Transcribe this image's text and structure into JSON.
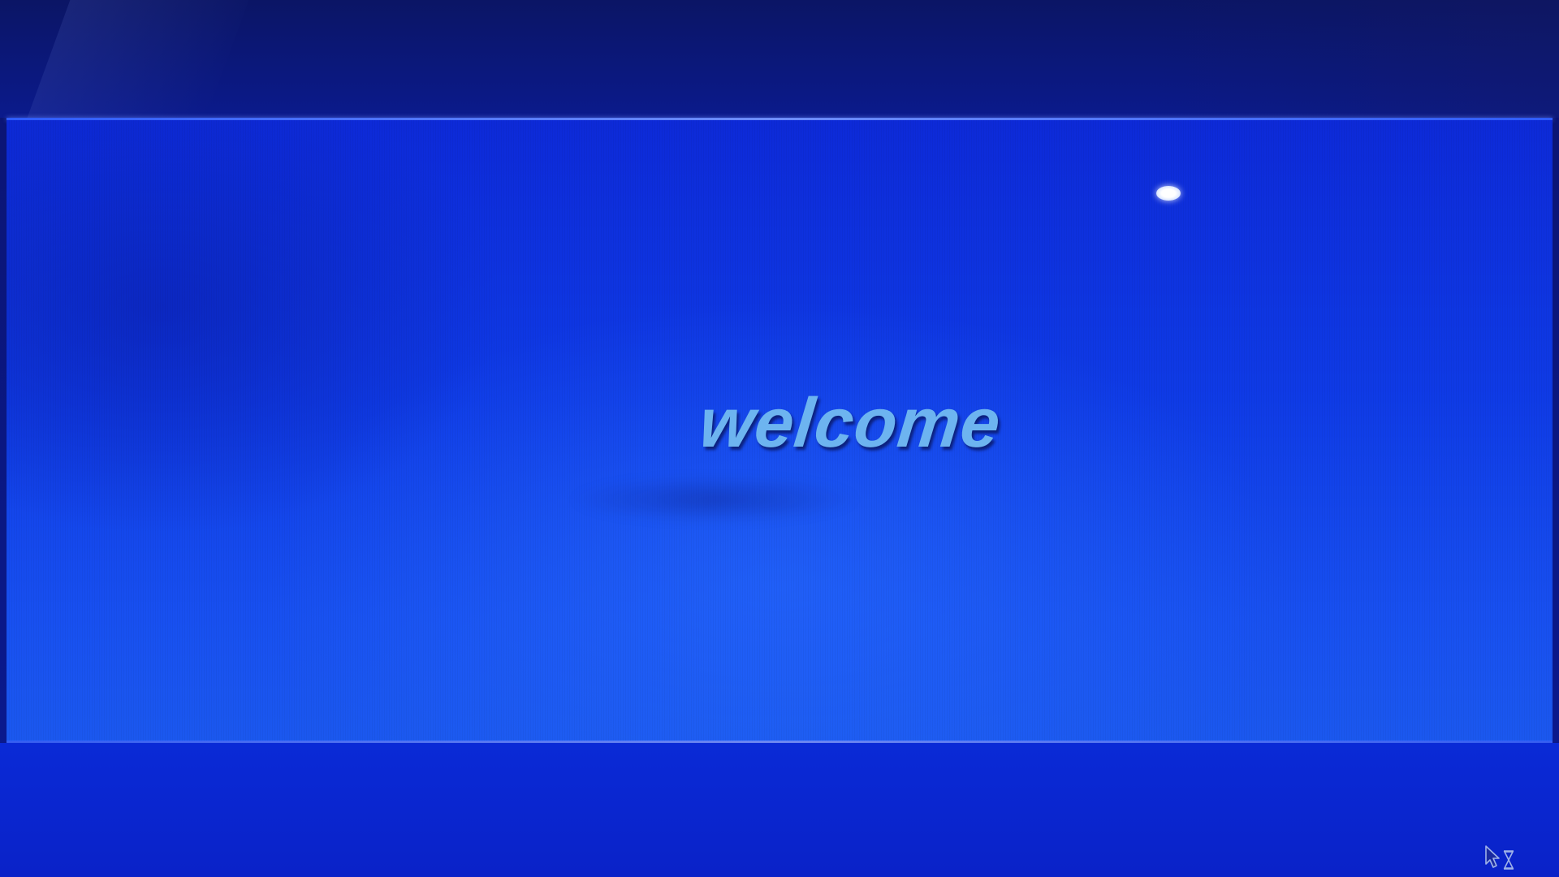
{
  "screen": {
    "welcome_text": "welcome",
    "colors": {
      "background_dark": "#0b1565",
      "panel_blue": "#0f3be6",
      "welcome_text": "#6db4f0"
    },
    "icons": [
      "light-dot-icon",
      "busy-cursor-icon"
    ]
  }
}
